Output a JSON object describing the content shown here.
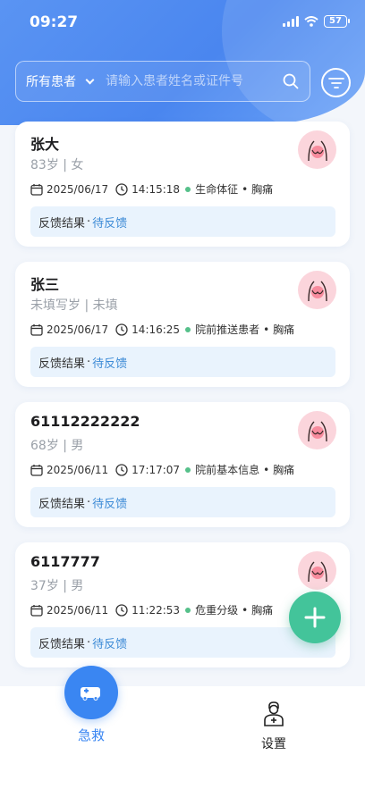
{
  "status_bar": {
    "time": "09:27",
    "battery": "57"
  },
  "search": {
    "filter_label": "所有患者",
    "placeholder": "请输入患者姓名或证件号"
  },
  "patients": [
    {
      "name": "张大",
      "info": "83岁 | 女",
      "date": "2025/06/17",
      "time": "14:15:18",
      "stage": "生命体征",
      "separator": "•",
      "complaint": "胸痛",
      "feedback_label": "反馈结果",
      "feedback_sep": "·",
      "feedback_status": "待反馈"
    },
    {
      "name": "张三",
      "info": "未填写岁 | 未填",
      "date": "2025/06/17",
      "time": "14:16:25",
      "stage": "院前推送患者",
      "separator": "•",
      "complaint": "胸痛",
      "feedback_label": "反馈结果",
      "feedback_sep": "·",
      "feedback_status": "待反馈"
    },
    {
      "name": "61112222222",
      "info": "68岁 | 男",
      "date": "2025/06/11",
      "time": "17:17:07",
      "stage": "院前基本信息",
      "separator": "•",
      "complaint": "胸痛",
      "feedback_label": "反馈结果",
      "feedback_sep": "·",
      "feedback_status": "待反馈"
    },
    {
      "name": "6117777",
      "info": "37岁 | 男",
      "date": "2025/06/11",
      "time": "11:22:53",
      "stage": "危重分级",
      "separator": "•",
      "complaint": "胸痛",
      "feedback_label": "反馈结果",
      "feedback_sep": "·",
      "feedback_status": "待反馈"
    }
  ],
  "nav": {
    "emergency_label": "急救",
    "settings_label": "设置"
  },
  "colors": {
    "primary": "#3a86f2",
    "fab": "#43c49a",
    "stage_dot": "#55c08a",
    "feedback_value": "#3b8ad6",
    "chest_badge": "#fbd5dc"
  },
  "icons": {
    "search": "search-icon",
    "filter": "filter-icon",
    "chest": "chest-pain-icon",
    "add": "plus-icon",
    "ambulance": "ambulance-icon",
    "settings": "doctor-settings-icon"
  }
}
